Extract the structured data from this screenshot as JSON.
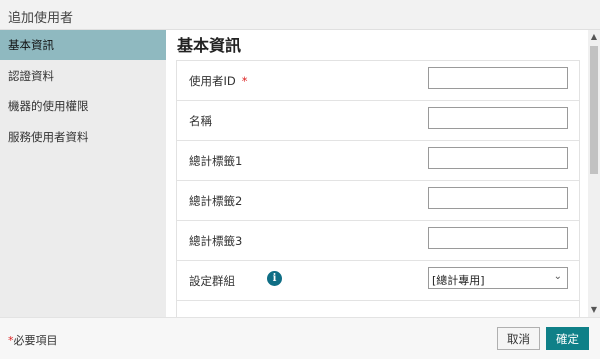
{
  "dialog": {
    "title": "追加使用者"
  },
  "sidebar": {
    "items": [
      {
        "label": "基本資訊",
        "active": true
      },
      {
        "label": "認證資料",
        "active": false
      },
      {
        "label": "機器的使用權限",
        "active": false
      },
      {
        "label": "服務使用者資料",
        "active": false
      }
    ]
  },
  "main": {
    "section_title": "基本資訊",
    "fields": [
      {
        "label": "使用者ID",
        "required_mark": "*",
        "value": ""
      },
      {
        "label": "名稱",
        "value": ""
      },
      {
        "label": "總計標籤1",
        "value": ""
      },
      {
        "label": "總計標籤2",
        "value": ""
      },
      {
        "label": "總計標籤3",
        "value": ""
      }
    ],
    "group": {
      "label": "設定群組",
      "info_icon": "i",
      "selected": "[總計專用]"
    }
  },
  "footer": {
    "required_star": "*",
    "required_note": "必要項目",
    "cancel_label": "取消",
    "ok_label": "確定"
  },
  "colors": {
    "accent": "#0f8088",
    "sidebar_active": "#8fb9c0",
    "required": "#dd2222"
  }
}
